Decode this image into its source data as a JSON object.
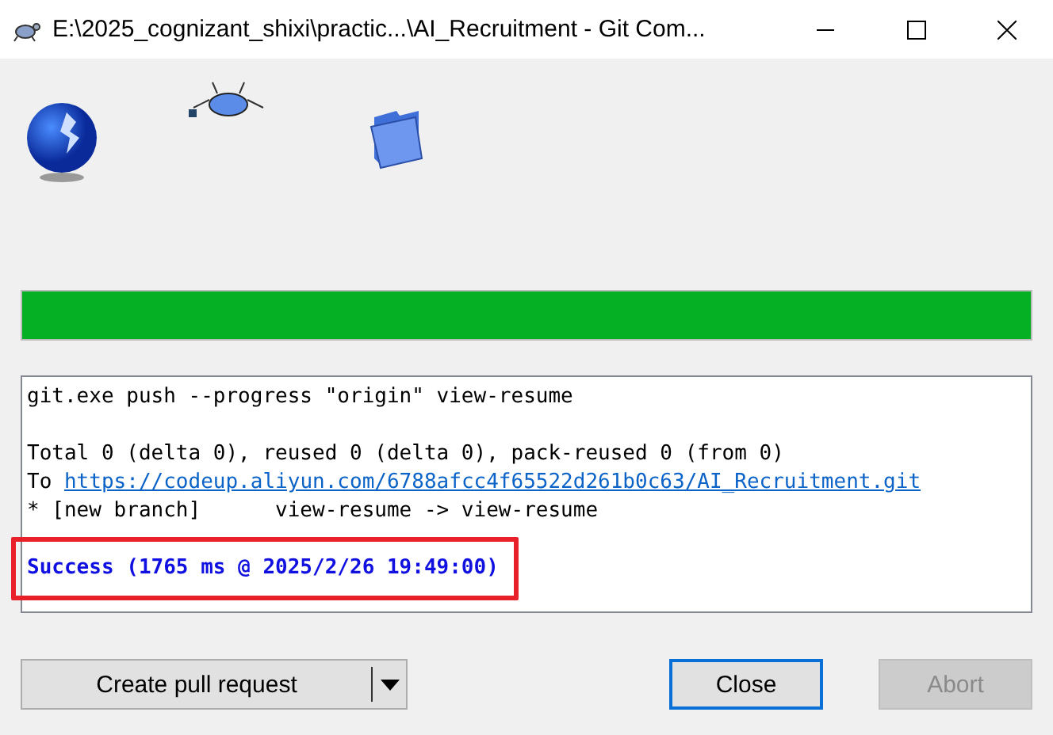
{
  "window": {
    "title": "E:\\2025_cognizant_shixi\\practic...\\AI_Recruitment - Git Com..."
  },
  "progress": {
    "level": 1
  },
  "log": [
    {
      "kind": "text",
      "text": "git.exe push --progress \"origin\" view-resume",
      "gap_before": false,
      "highlighted": false
    },
    {
      "kind": "text",
      "text": "Total 0 (delta 0), reused 0 (delta 0), pack-reused 0 (from 0)",
      "gap_before": true,
      "highlighted": false
    },
    {
      "kind": "link",
      "prefix": "To",
      "text": "https://codeup.aliyun.com/6788afcc4f65522d261b0c63/AI_Recruitment.git",
      "gap_before": false,
      "highlighted": false
    },
    {
      "kind": "text",
      "text": "* [new branch]      view-resume -> view-resume",
      "gap_before": false,
      "highlighted": false
    },
    {
      "kind": "success",
      "text": "Success (1765 ms @ 2025/2/26 19:49:00)",
      "gap_before": true,
      "highlighted": true
    }
  ],
  "buttons": [
    {
      "kind": "split",
      "label": "Create pull request",
      "disabled": false,
      "focused": false
    },
    {
      "kind": "plain",
      "label": "Close",
      "disabled": false,
      "focused": true
    },
    {
      "kind": "plain",
      "label": "Abort",
      "disabled": true,
      "focused": false
    }
  ]
}
